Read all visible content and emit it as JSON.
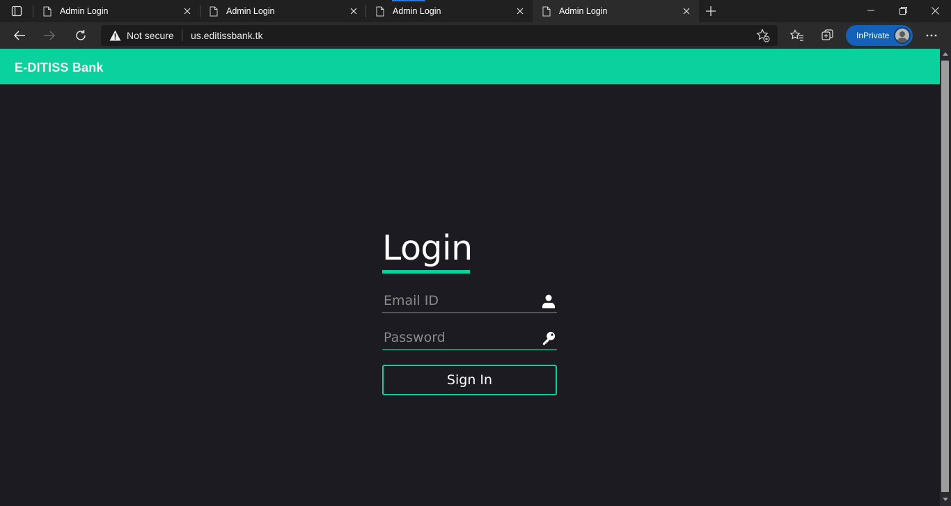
{
  "browser": {
    "tabs": [
      {
        "title": "Admin Login",
        "active": false
      },
      {
        "title": "Admin Login",
        "active": false
      },
      {
        "title": "Admin Login",
        "active": false
      },
      {
        "title": "Admin Login",
        "active": true
      }
    ],
    "security_label": "Not secure",
    "url": "us.editissbank.tk",
    "inprivate_label": "InPrivate"
  },
  "page": {
    "brand": "E-DITISS Bank",
    "accent_color": "#0ad19d",
    "background_color": "#1c1b21",
    "login": {
      "title": "Login",
      "email_placeholder": "Email ID",
      "password_placeholder": "Password",
      "submit_label": "Sign In"
    }
  }
}
